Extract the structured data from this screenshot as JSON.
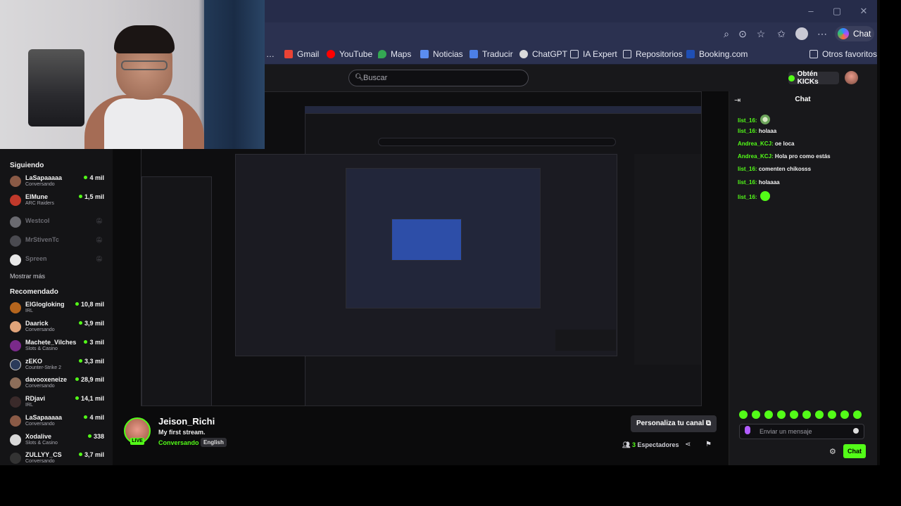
{
  "browser": {
    "bookmarks": [
      "Gmail",
      "YouTube",
      "Maps",
      "Noticias",
      "Traducir",
      "ChatGPT",
      "IA Expert",
      "Repositorios",
      "Booking.com"
    ],
    "other_favorites": "Otros favoritos",
    "chat_label": "Chat"
  },
  "kick": {
    "search_placeholder": "Buscar",
    "get_kicks": "Obtén KICKs"
  },
  "sidebar": {
    "following_title": "Siguiendo",
    "following": [
      {
        "name": "LaSapaaaaa",
        "sub": "Conversando",
        "count": "4 mil",
        "live": true
      },
      {
        "name": "ElMune",
        "sub": "ARC Raiders",
        "count": "1,5 mil",
        "live": true
      },
      {
        "name": "Westcol",
        "sub": "",
        "count": "",
        "live": false
      },
      {
        "name": "MrStivenTc",
        "sub": "",
        "count": "",
        "live": false
      },
      {
        "name": "Spreen",
        "sub": "",
        "count": "",
        "live": false
      }
    ],
    "show_more": "Mostrar más",
    "recommended_title": "Recomendado",
    "recommended": [
      {
        "name": "ElGlogloking",
        "sub": "IRL",
        "count": "10,8 mil"
      },
      {
        "name": "Daarick",
        "sub": "Conversando",
        "count": "3,9 mil"
      },
      {
        "name": "Machete_Vilches",
        "sub": "Slots & Casino",
        "count": "3 mil"
      },
      {
        "name": "zEKO",
        "sub": "Counter-Strike 2",
        "count": "3,3 mil"
      },
      {
        "name": "davooxeneize",
        "sub": "Conversando",
        "count": "28,9 mil"
      },
      {
        "name": "RDjavi",
        "sub": "IRL",
        "count": "14,1 mil"
      },
      {
        "name": "LaSapaaaaa",
        "sub": "Conversando",
        "count": "4 mil"
      },
      {
        "name": "Xodalive",
        "sub": "Slots & Casino",
        "count": "338"
      },
      {
        "name": "ZULLYY_CS",
        "sub": "Conversando",
        "count": "3,7 mil"
      }
    ]
  },
  "channel": {
    "name": "Jeison_Richi",
    "live_badge": "LIVE",
    "title": "My first stream.",
    "category": "Conversando",
    "language": "English",
    "customize_button": "Personaliza tu canal",
    "viewers_count": "3",
    "viewers_label": "Espectadores"
  },
  "chat": {
    "title": "Chat",
    "messages": [
      {
        "user": "list_16:",
        "text": "",
        "emote": true
      },
      {
        "user": "list_16:",
        "text": "holaaa",
        "emote": false
      },
      {
        "user": "Andrea_KCJ:",
        "text": "oe loca",
        "emote": false
      },
      {
        "user": "Andrea_KCJ:",
        "text": "Hola pro como estás",
        "emote": false
      },
      {
        "user": "list_16:",
        "text": "comenten chikosss",
        "emote": false
      },
      {
        "user": "list_16:",
        "text": "holaaaa",
        "emote": false
      },
      {
        "user": "list_16:",
        "text": "",
        "emote": true
      }
    ],
    "input_placeholder": "Enviar un mensaje",
    "send_button": "Chat"
  },
  "colors": {
    "accent": "#53fc18",
    "background": "#18181b"
  }
}
